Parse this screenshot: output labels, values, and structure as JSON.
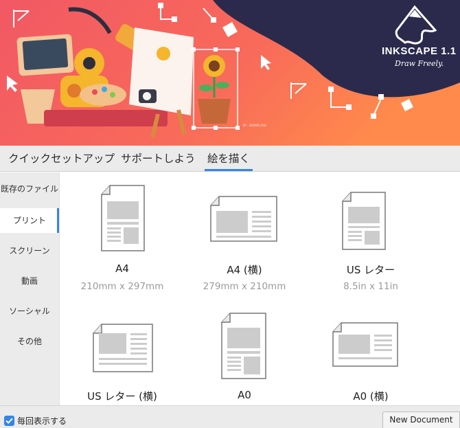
{
  "banner": {
    "logo_text": "INKSCAPE 1.1",
    "tagline": "Draw Freely.",
    "credit": "BY : DZAMFLASH"
  },
  "tabs": [
    {
      "label": "クイックセットアップ",
      "active": false
    },
    {
      "label": "サポートしよう",
      "active": false
    },
    {
      "label": "絵を描く",
      "active": true
    }
  ],
  "sidebar": {
    "items": [
      {
        "label": "既存のファイル",
        "active": false
      },
      {
        "label": "プリント",
        "active": true
      },
      {
        "label": "スクリーン",
        "active": false
      },
      {
        "label": "動画",
        "active": false
      },
      {
        "label": "ソーシャル",
        "active": false
      },
      {
        "label": "その他",
        "active": false
      }
    ]
  },
  "templates": [
    {
      "name": "A4",
      "size": "210mm x 297mm",
      "orientation": "portrait"
    },
    {
      "name": "A4 (横)",
      "size": "279mm x 210mm",
      "orientation": "landscape"
    },
    {
      "name": "US レター",
      "size": "8.5in x 11in",
      "orientation": "portrait"
    },
    {
      "name": "US レター (横)",
      "size": "",
      "orientation": "landscape"
    },
    {
      "name": "A0",
      "size": "",
      "orientation": "portrait"
    },
    {
      "name": "A0 (横)",
      "size": "",
      "orientation": "landscape"
    }
  ],
  "footer": {
    "show_every_time_label": "毎回表示する",
    "show_every_time_checked": true,
    "new_document_label": "New Document"
  },
  "colors": {
    "accent": "#3584e4",
    "banner_coral": "#f4605e",
    "banner_navy": "#2b2a4c"
  }
}
